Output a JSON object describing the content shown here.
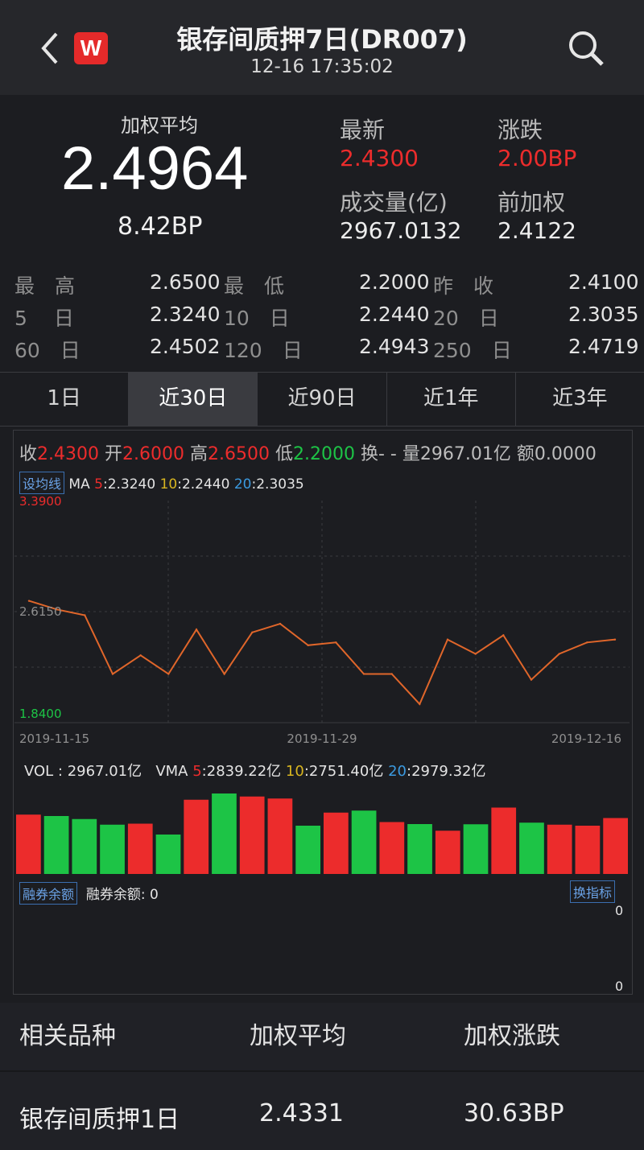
{
  "header": {
    "title": "银存间质押7日(DR007)",
    "timestamp": "12-16 17:35:02",
    "logo_text": "W",
    "back_icon": "chevron-left-icon",
    "search_icon": "search-icon"
  },
  "quote": {
    "weighted_avg_label": "加权平均",
    "weighted_avg_value": "2.4964",
    "weighted_change": "8.42BP",
    "latest_label": "最新",
    "latest_value": "2.4300",
    "change_label": "涨跌",
    "change_value": "2.00BP",
    "volume_label": "成交量(亿)",
    "volume_value": "2967.0132",
    "prev_weighted_label": "前加权",
    "prev_weighted_value": "2.4122"
  },
  "stats": [
    [
      {
        "k": "最　高",
        "v": "2.6500"
      },
      {
        "k": "最　低",
        "v": "2.2000"
      },
      {
        "k": "昨　收",
        "v": "2.4100"
      }
    ],
    [
      {
        "k": "5　 日",
        "v": "2.3240"
      },
      {
        "k": "10　日",
        "v": "2.2440"
      },
      {
        "k": "20　日",
        "v": "2.3035"
      }
    ],
    [
      {
        "k": "60　日",
        "v": "2.4502"
      },
      {
        "k": "120　日",
        "v": "2.4943"
      },
      {
        "k": "250　日",
        "v": "2.4719"
      }
    ]
  ],
  "tabs": [
    {
      "label": "1日",
      "active": false
    },
    {
      "label": "近30日",
      "active": true
    },
    {
      "label": "近90日",
      "active": false
    },
    {
      "label": "近1年",
      "active": false
    },
    {
      "label": "近3年",
      "active": false
    }
  ],
  "ohlc": {
    "close_label": "收",
    "close": "2.4300",
    "open_label": "开",
    "open": "2.6000",
    "high_label": "高",
    "high": "2.6500",
    "low_label": "低",
    "low": "2.2000",
    "turnover": "换- -",
    "volume": "量2967.01亿",
    "amount": "额0.0000"
  },
  "ma": {
    "set_button": "设均线",
    "label": "MA",
    "ma5_key": "5",
    "ma5": "2.3240",
    "ma10_key": "10",
    "ma10": "2.2440",
    "ma20_key": "20",
    "ma20": "2.3035"
  },
  "vol_row": {
    "label": "VOL : 2967.01亿",
    "vma_label": "VMA",
    "vma5_key": "5",
    "vma5": "2839.22亿",
    "vma10_key": "10",
    "vma10": "2751.40亿",
    "vma20_key": "20",
    "vma20": "2979.32亿"
  },
  "margin": {
    "button": "融券余额",
    "text": "融券余额: 0",
    "switch_button": "换指标",
    "top_zero": "0",
    "bottom_zero": "0"
  },
  "related": {
    "col1": "相关品种",
    "col2": "加权平均",
    "col3": "加权涨跌",
    "rows": [
      {
        "name": "银存间质押1日",
        "avg": "2.4331",
        "change": "30.63BP"
      }
    ]
  },
  "colors": {
    "up": "#ec2c2c",
    "down": "#1dc446",
    "line": "#e0662a",
    "ma5": "#ec2c2c",
    "ma10": "#d8b520",
    "ma20": "#3b9ae0"
  },
  "chart_data": [
    {
      "type": "line",
      "y_axis_labels": [
        "3.3900",
        "2.6150",
        "1.8400"
      ],
      "ylim": [
        1.84,
        3.39
      ],
      "x_tick_labels": [
        "2019-11-15",
        "2019-11-29",
        "2019-12-16"
      ],
      "values": [
        2.69,
        2.63,
        2.59,
        2.18,
        2.31,
        2.18,
        2.49,
        2.18,
        2.47,
        2.53,
        2.38,
        2.4,
        2.18,
        2.18,
        1.97,
        2.42,
        2.32,
        2.45,
        2.14,
        2.32,
        2.4,
        2.42
      ]
    },
    {
      "type": "bar",
      "series_colors": [
        "up",
        "down",
        "down",
        "down",
        "up",
        "down",
        "up",
        "down",
        "up",
        "up",
        "down",
        "up",
        "down",
        "up",
        "down",
        "up",
        "down",
        "up",
        "down",
        "up",
        "up",
        "up"
      ],
      "values": [
        2950,
        2880,
        2730,
        2450,
        2500,
        1960,
        3690,
        4000,
        3850,
        3750,
        2400,
        3050,
        3150,
        2580,
        2480,
        2150,
        2470,
        3300,
        2550,
        2450,
        2400,
        2780
      ]
    }
  ]
}
